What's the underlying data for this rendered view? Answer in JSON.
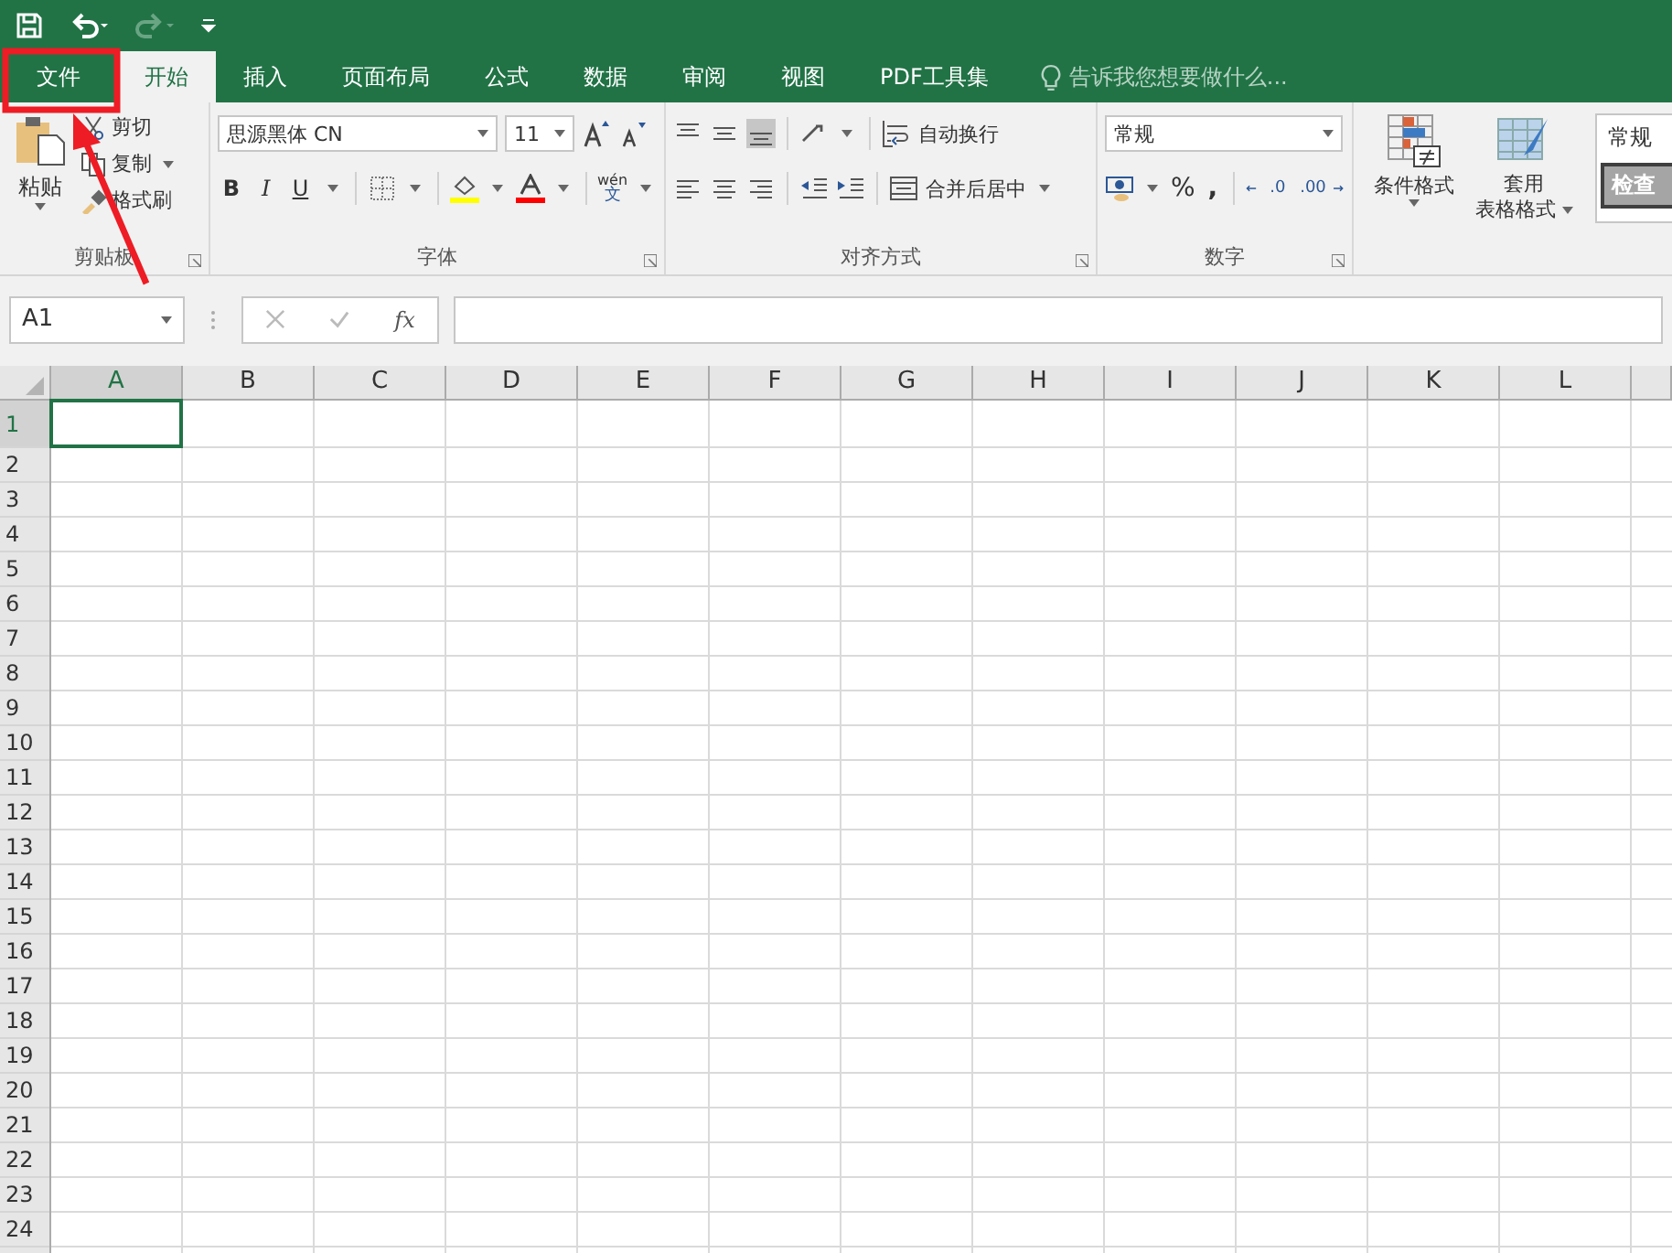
{
  "tabs": [
    {
      "label": "文件",
      "selected": false
    },
    {
      "label": "开始",
      "selected": true
    },
    {
      "label": "插入",
      "selected": false
    },
    {
      "label": "页面布局",
      "selected": false
    },
    {
      "label": "公式",
      "selected": false
    },
    {
      "label": "数据",
      "selected": false
    },
    {
      "label": "审阅",
      "selected": false
    },
    {
      "label": "视图",
      "selected": false
    },
    {
      "label": "PDF工具集",
      "selected": false
    }
  ],
  "tell_me": {
    "placeholder": "告诉我您想要做什么..."
  },
  "clipboard": {
    "paste": "粘贴",
    "cut": "剪切",
    "copy": "复制",
    "format_painter": "格式刷",
    "label": "剪贴板"
  },
  "font": {
    "name": "思源黑体 CN",
    "size": "11",
    "bold": "B",
    "italic": "I",
    "underline": "U",
    "phonetic_top": "wén",
    "phonetic_bottom": "文",
    "label": "字体"
  },
  "alignment": {
    "wrap": "自动换行",
    "merge": "合并后居中",
    "label": "对齐方式"
  },
  "number": {
    "format": "常规",
    "percent": "%",
    "comma": ",",
    "increase": ".0",
    "decrease": ".00",
    "label": "数字"
  },
  "styles": {
    "conditional": "条件格式",
    "table_top": "套用",
    "table_bottom": "表格格式",
    "normal": "常规",
    "check": "检查"
  },
  "formula_bar": {
    "name_box": "A1",
    "fx": "fx"
  },
  "columns": [
    {
      "label": "A",
      "selected": true
    },
    {
      "label": "B",
      "selected": false
    },
    {
      "label": "C",
      "selected": false
    },
    {
      "label": "D",
      "selected": false
    },
    {
      "label": "E",
      "selected": false
    },
    {
      "label": "F",
      "selected": false
    },
    {
      "label": "G",
      "selected": false
    },
    {
      "label": "H",
      "selected": false
    },
    {
      "label": "I",
      "selected": false
    },
    {
      "label": "J",
      "selected": false
    },
    {
      "label": "K",
      "selected": false
    },
    {
      "label": "L",
      "selected": false
    }
  ],
  "rows": [
    {
      "label": "1",
      "selected": true
    },
    {
      "label": "2",
      "selected": false
    },
    {
      "label": "3",
      "selected": false
    },
    {
      "label": "4",
      "selected": false
    },
    {
      "label": "5",
      "selected": false
    },
    {
      "label": "6",
      "selected": false
    },
    {
      "label": "7",
      "selected": false
    },
    {
      "label": "8",
      "selected": false
    },
    {
      "label": "9",
      "selected": false
    },
    {
      "label": "10",
      "selected": false
    },
    {
      "label": "11",
      "selected": false
    },
    {
      "label": "12",
      "selected": false
    },
    {
      "label": "13",
      "selected": false
    },
    {
      "label": "14",
      "selected": false
    },
    {
      "label": "15",
      "selected": false
    },
    {
      "label": "16",
      "selected": false
    },
    {
      "label": "17",
      "selected": false
    },
    {
      "label": "18",
      "selected": false
    },
    {
      "label": "19",
      "selected": false
    },
    {
      "label": "20",
      "selected": false
    },
    {
      "label": "21",
      "selected": false
    },
    {
      "label": "22",
      "selected": false
    },
    {
      "label": "23",
      "selected": false
    },
    {
      "label": "24",
      "selected": false
    }
  ]
}
